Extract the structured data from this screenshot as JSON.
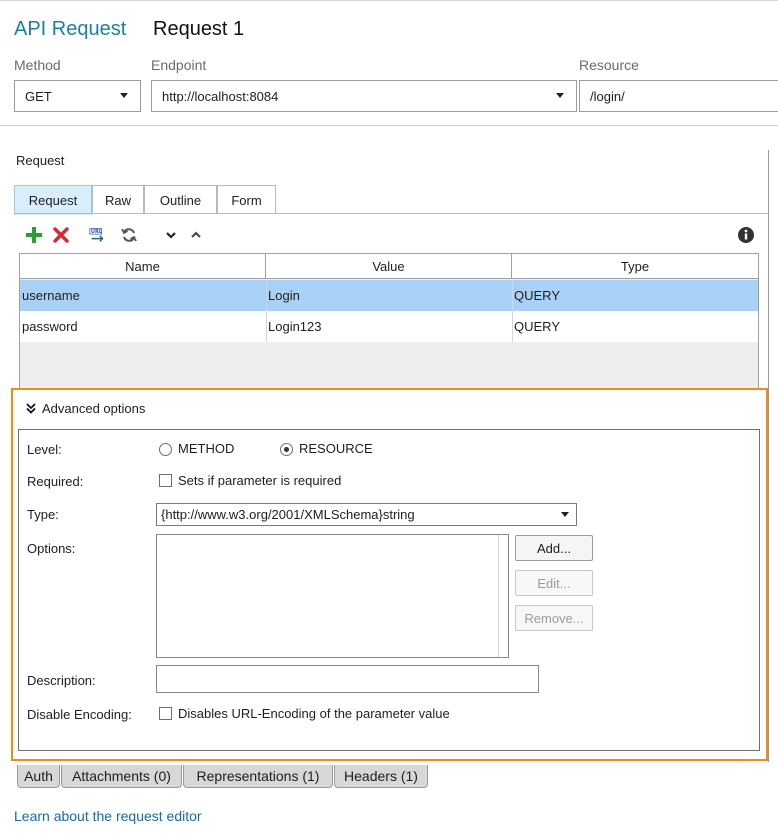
{
  "header": {
    "title_prefix": "API Request",
    "title_name": "Request 1",
    "method_label": "Method",
    "endpoint_label": "Endpoint",
    "resource_label": "Resource",
    "method_value": "GET",
    "endpoint_value": "http://localhost:8084",
    "resource_value": "/login/"
  },
  "request": {
    "section_title": "Request",
    "tabs": [
      {
        "label": "Request",
        "active": true
      },
      {
        "label": "Raw",
        "active": false
      },
      {
        "label": "Outline",
        "active": false
      },
      {
        "label": "Form",
        "active": false
      }
    ],
    "toolbar": [
      "add-icon",
      "delete-icon",
      "url-encode-icon",
      "refresh-icon",
      "move-down-icon",
      "move-up-icon",
      "info-icon"
    ],
    "columns": [
      "Name",
      "Value",
      "Type"
    ],
    "rows": [
      {
        "name": "username",
        "value": "Login",
        "type": "QUERY",
        "selected": true
      },
      {
        "name": "password",
        "value": "Login123",
        "type": "QUERY",
        "selected": false
      }
    ]
  },
  "advanced": {
    "title": "Advanced options",
    "level_label": "Level:",
    "level_options": [
      "METHOD",
      "RESOURCE"
    ],
    "level_selected": "RESOURCE",
    "required_label": "Required:",
    "required_text": "Sets if parameter is required",
    "type_label": "Type:",
    "type_value": "{http://www.w3.org/2001/XMLSchema}string",
    "options_label": "Options:",
    "buttons": {
      "add": "Add...",
      "edit": "Edit...",
      "remove": "Remove..."
    },
    "description_label": "Description:",
    "description_value": "",
    "disable_encoding_label": "Disable Encoding:",
    "disable_encoding_text": "Disables URL-Encoding of the parameter value"
  },
  "bottom_tabs": [
    "Auth",
    "Attachments (0)",
    "Representations (1)",
    "Headers (1)"
  ],
  "footer": {
    "learn_link": "Learn about the request editor"
  },
  "colors": {
    "accent": "#1a7fa5",
    "highlight_border": "#f08a1c",
    "selected_row": "#a9d0f5",
    "add_green": "#2e9e2e",
    "delete_red": "#d9282f"
  }
}
